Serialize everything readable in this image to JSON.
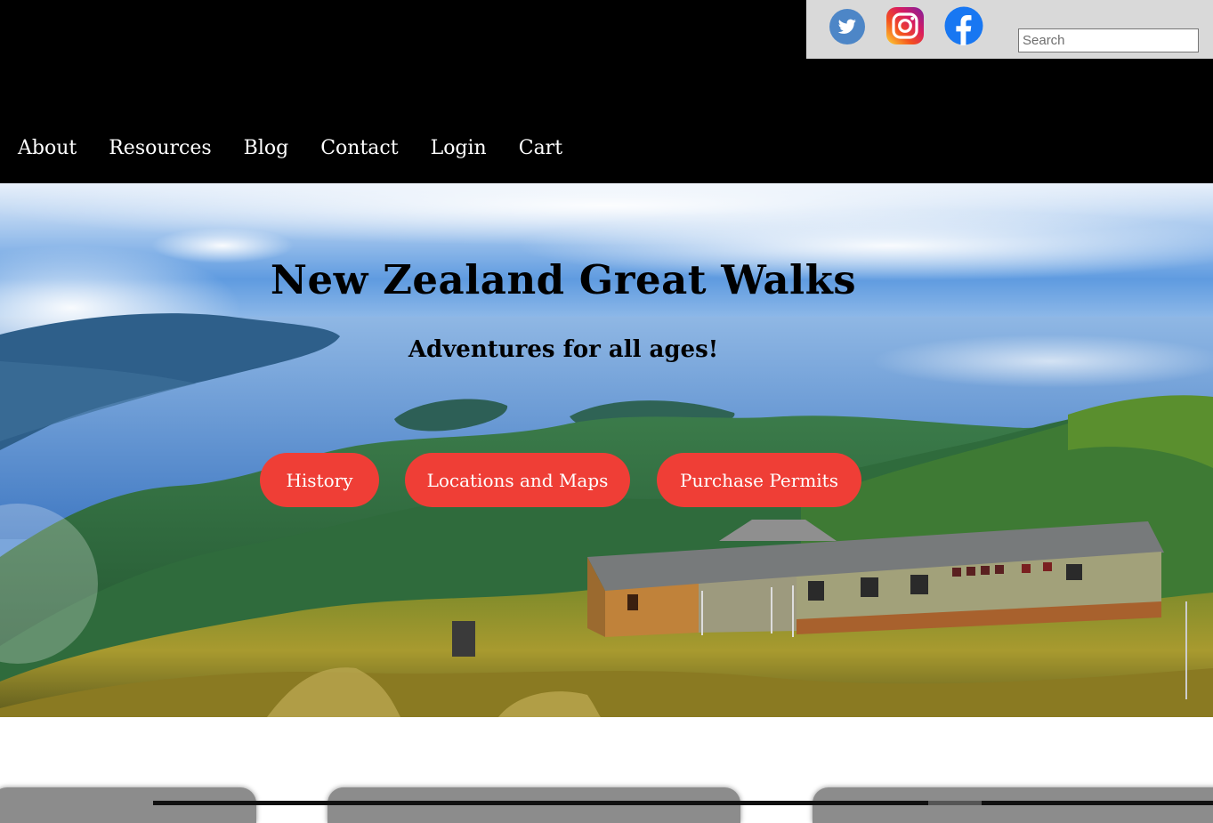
{
  "social": {
    "icons": [
      "twitter-icon",
      "instagram-icon",
      "facebook-icon"
    ],
    "search_placeholder": "Search"
  },
  "nav": {
    "items": [
      {
        "label": "About"
      },
      {
        "label": "Resources"
      },
      {
        "label": "Blog"
      },
      {
        "label": "Contact"
      },
      {
        "label": "Login"
      },
      {
        "label": "Cart"
      }
    ]
  },
  "hero": {
    "title": "New Zealand Great Walks",
    "subtitle": "Adventures for all ages!",
    "buttons": [
      {
        "label": "History"
      },
      {
        "label": "Locations and Maps"
      },
      {
        "label": "Purchase Permits"
      }
    ]
  },
  "colors": {
    "header_bg": "#000000",
    "social_bar_bg": "#d9d9d9",
    "button_bg": "#ef3e36",
    "button_text": "#ffffff"
  }
}
